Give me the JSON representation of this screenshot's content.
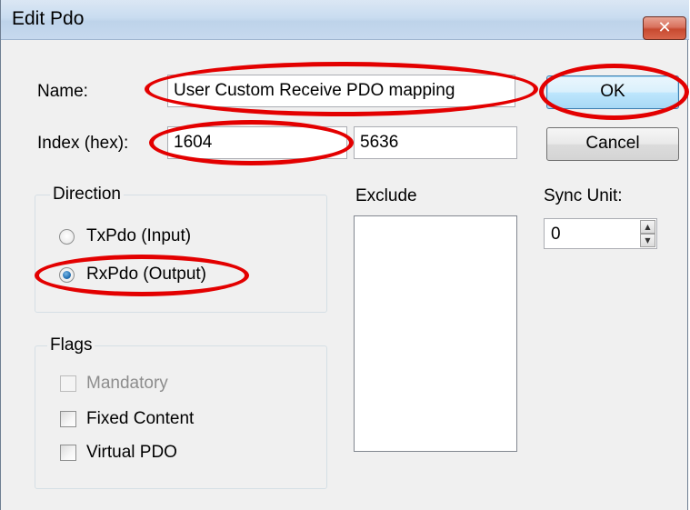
{
  "window": {
    "title": "Edit Pdo",
    "close_glyph": "✕"
  },
  "name": {
    "label": "Name:",
    "value": "User Custom Receive PDO mapping"
  },
  "index": {
    "label": "Index (hex):",
    "value": "1604",
    "value2": "5636"
  },
  "buttons": {
    "ok": "OK",
    "cancel": "Cancel"
  },
  "direction": {
    "title": "Direction",
    "options": [
      {
        "label": "TxPdo (Input)",
        "checked": false
      },
      {
        "label": "RxPdo (Output)",
        "checked": true
      }
    ]
  },
  "exclude": {
    "label": "Exclude",
    "items": []
  },
  "sync_unit": {
    "label": "Sync Unit:",
    "value": "0"
  },
  "flags": {
    "title": "Flags",
    "items": [
      {
        "label": "Mandatory",
        "checked": false,
        "enabled": false
      },
      {
        "label": "Fixed Content",
        "checked": false,
        "enabled": true
      },
      {
        "label": "Virtual PDO",
        "checked": false,
        "enabled": true
      }
    ]
  },
  "highlight_color": "#e30000"
}
